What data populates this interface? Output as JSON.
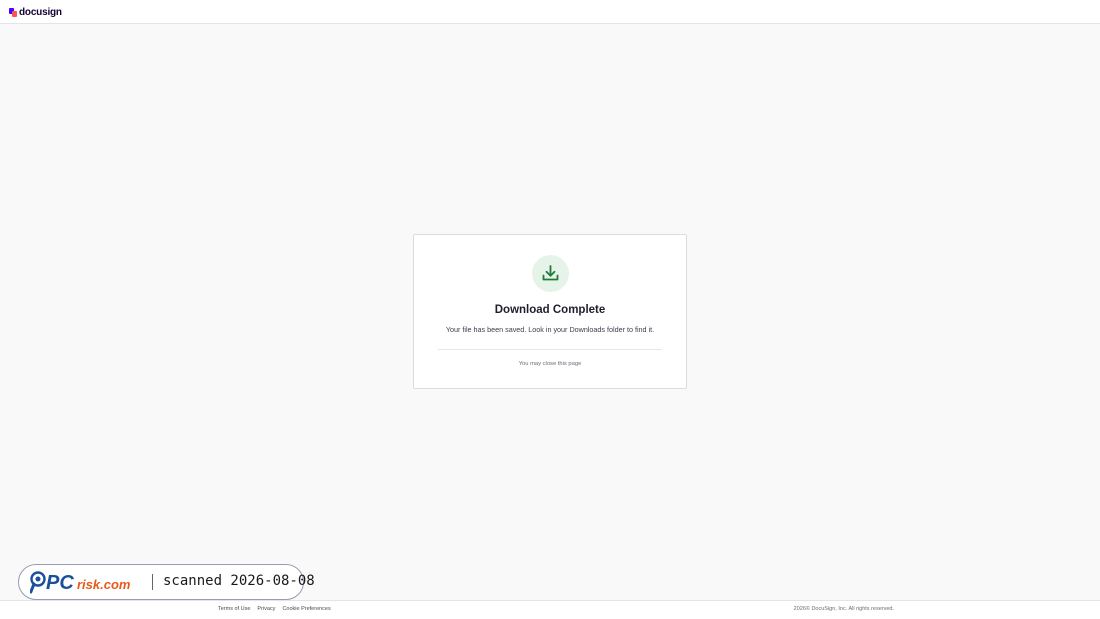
{
  "header": {
    "logo_text": "docusign",
    "logo_colors": {
      "primary": "#4c00ff",
      "secondary": "#ff5252"
    }
  },
  "card": {
    "icon": "download-icon",
    "icon_color": "#1e7b3b",
    "icon_bg": "#e5f3e9",
    "title": "Download Complete",
    "message": "Your file has been saved. Look in your Downloads folder to find it.",
    "note": "You may close this page"
  },
  "watermark": {
    "brand": "PCrisk.com",
    "text": "scanned 2026-08-08"
  },
  "footer": {
    "links": [
      "Terms of Use",
      "Privacy",
      "Cookie Preferences"
    ],
    "copyright": "2026© DocuSign, Inc. All rights reserved."
  }
}
